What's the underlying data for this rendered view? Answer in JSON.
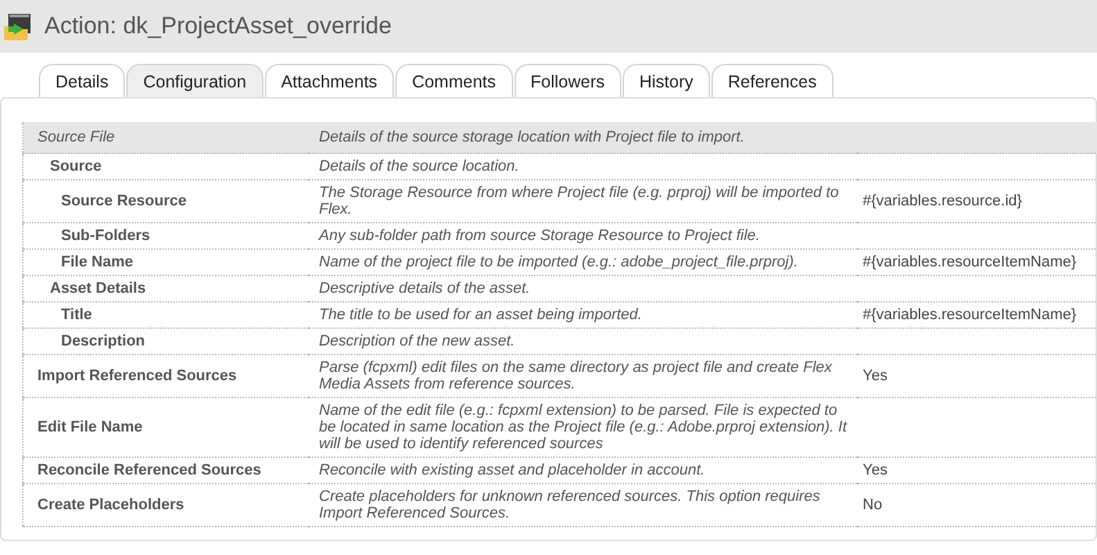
{
  "window": {
    "title": "Action: dk_ProjectAsset_override"
  },
  "tabs": [
    {
      "label": "Details",
      "selected": false
    },
    {
      "label": "Configuration",
      "selected": true
    },
    {
      "label": "Attachments",
      "selected": false
    },
    {
      "label": "Comments",
      "selected": false
    },
    {
      "label": "Followers",
      "selected": false
    },
    {
      "label": "History",
      "selected": false
    },
    {
      "label": "References",
      "selected": false
    }
  ],
  "table": {
    "rows": [
      {
        "kind": "section",
        "name": "Source File",
        "description": "Details of the source storage location with Project file to import.",
        "children": [
          {
            "kind": "field",
            "name": "Source",
            "description": "Details of the source location.",
            "children": [
              {
                "kind": "field",
                "name": "Source Resource",
                "description": "The Storage Resource from where Project file (e.g. prproj) will be imported to Flex.",
                "value": "#{variables.resource.id}"
              },
              {
                "kind": "field",
                "name": "Sub-Folders",
                "description": "Any sub-folder path from source Storage Resource to Project file."
              },
              {
                "kind": "field",
                "name": "File Name",
                "description": "Name of the project file to be imported (e.g.: adobe_project_file.prproj).",
                "value": "#{variables.resourceItemName}"
              }
            ]
          },
          {
            "kind": "field",
            "name": "Asset Details",
            "description": "Descriptive details of the asset.",
            "children": [
              {
                "kind": "field",
                "name": "Title",
                "description": "The title to be used for an asset being imported.",
                "value": "#{variables.resourceItemName}"
              },
              {
                "kind": "field",
                "name": "Description",
                "description": "Description of the new asset."
              }
            ]
          }
        ]
      },
      {
        "kind": "field",
        "name": "Import Referenced Sources",
        "description": "Parse (fcpxml) edit files on the same directory as project file and create Flex Media Assets from reference sources.",
        "value": "Yes"
      },
      {
        "kind": "field",
        "name": "Edit File Name",
        "description": "Name of the edit file (e.g.: fcpxml extension) to be parsed. File is expected to be located in same location as the Project file (e.g.: Adobe.prproj extension). It will be used to identify referenced sources"
      },
      {
        "kind": "field",
        "name": "Reconcile Referenced Sources",
        "description": "Reconcile with existing asset and placeholder in account.",
        "value": "Yes"
      },
      {
        "kind": "field",
        "name": "Create Placeholders",
        "description": "Create placeholders for unknown referenced sources. This option requires Import Referenced Sources.",
        "value": "No"
      }
    ]
  }
}
